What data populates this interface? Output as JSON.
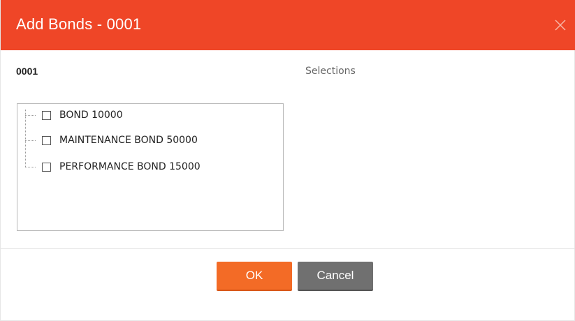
{
  "dialog": {
    "title": "Add Bonds - 0001",
    "close_icon": "close-icon",
    "record_label": "0001",
    "selections_label": "Selections"
  },
  "tree": {
    "items": [
      {
        "label": "BOND 10000",
        "checked": false
      },
      {
        "label": "MAINTENANCE BOND 50000",
        "checked": false
      },
      {
        "label": "PERFORMANCE BOND 15000",
        "checked": false
      }
    ]
  },
  "buttons": {
    "ok_label": "OK",
    "cancel_label": "Cancel"
  },
  "colors": {
    "titlebar": "#ef4627",
    "ok_button": "#f36b26",
    "cancel_button": "#707070"
  }
}
